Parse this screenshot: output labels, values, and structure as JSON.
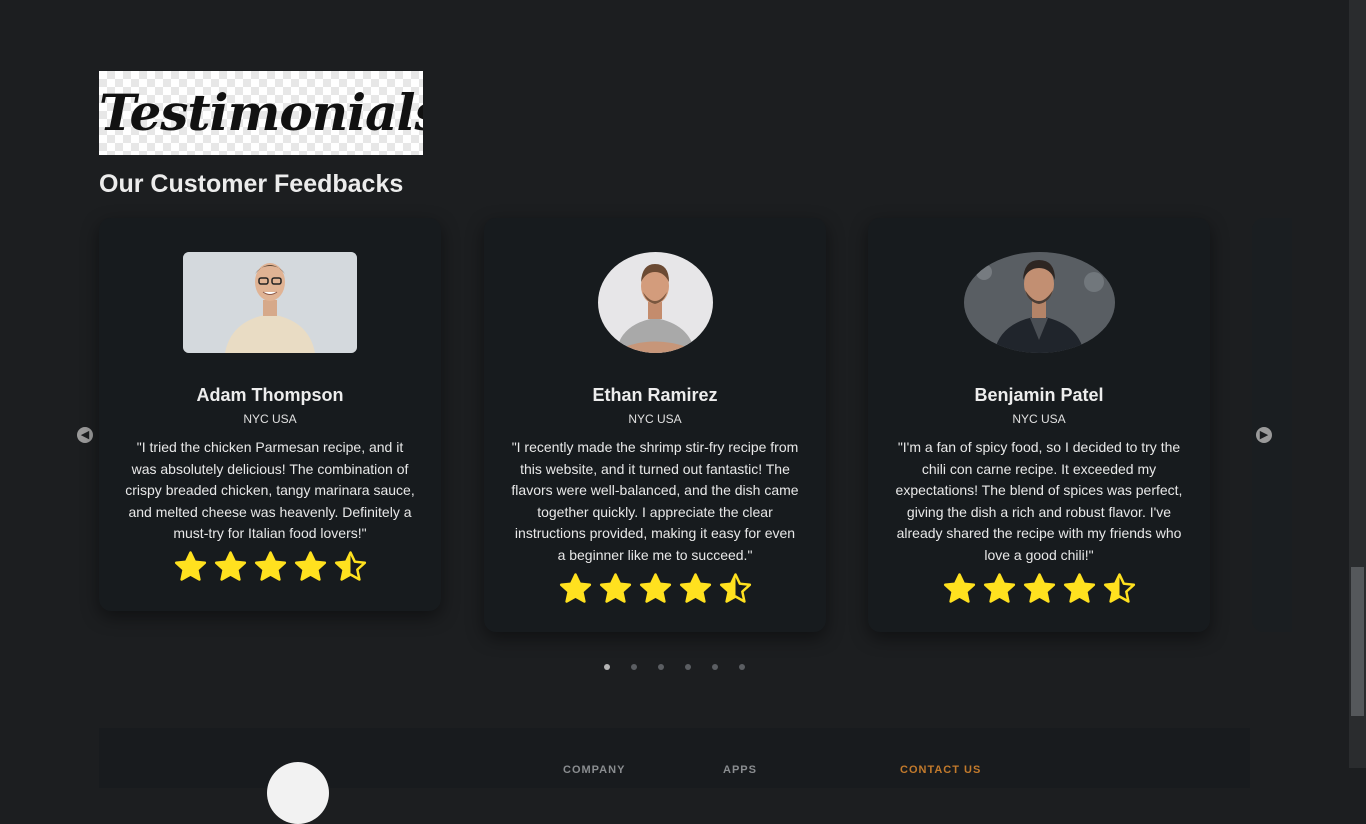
{
  "header": {
    "logo_text": "Testimonials",
    "title": "Our Customer Feedbacks"
  },
  "carousel": {
    "prev_icon": "◀",
    "next_icon": "▶",
    "dot_count": 6,
    "active_dot": 0,
    "star_color": "#ffe11f",
    "cards": [
      {
        "name": "Adam Thompson",
        "location": "NYC USA",
        "quote": "\"I tried the chicken Parmesan recipe, and it was absolutely delicious! The combination of crispy breaded chicken, tangy marinara sauce, and melted cheese was heavenly. Definitely a must-try for Italian food lovers!\"",
        "rating": 4.5
      },
      {
        "name": "Ethan Ramirez",
        "location": "NYC USA",
        "quote": "\"I recently made the shrimp stir-fry recipe from this website, and it turned out fantastic! The flavors were well-balanced, and the dish came together quickly. I appreciate the clear instructions provided, making it easy for even a beginner like me to succeed.\"",
        "rating": 4.5
      },
      {
        "name": "Benjamin Patel",
        "location": "NYC USA",
        "quote": "\"I'm a fan of spicy food, so I decided to try the chili con carne recipe. It exceeded my expectations! The blend of spices was perfect, giving the dish a rich and robust flavor. I've already shared the recipe with my friends who love a good chili!\"",
        "rating": 4.5
      }
    ]
  },
  "footer": {
    "col1": "COMPANY",
    "col2": "APPS",
    "col3": "CONTACT US"
  },
  "colors": {
    "background": "#1c1e20",
    "card": "#171b1e",
    "accent": "#c27a2c"
  }
}
